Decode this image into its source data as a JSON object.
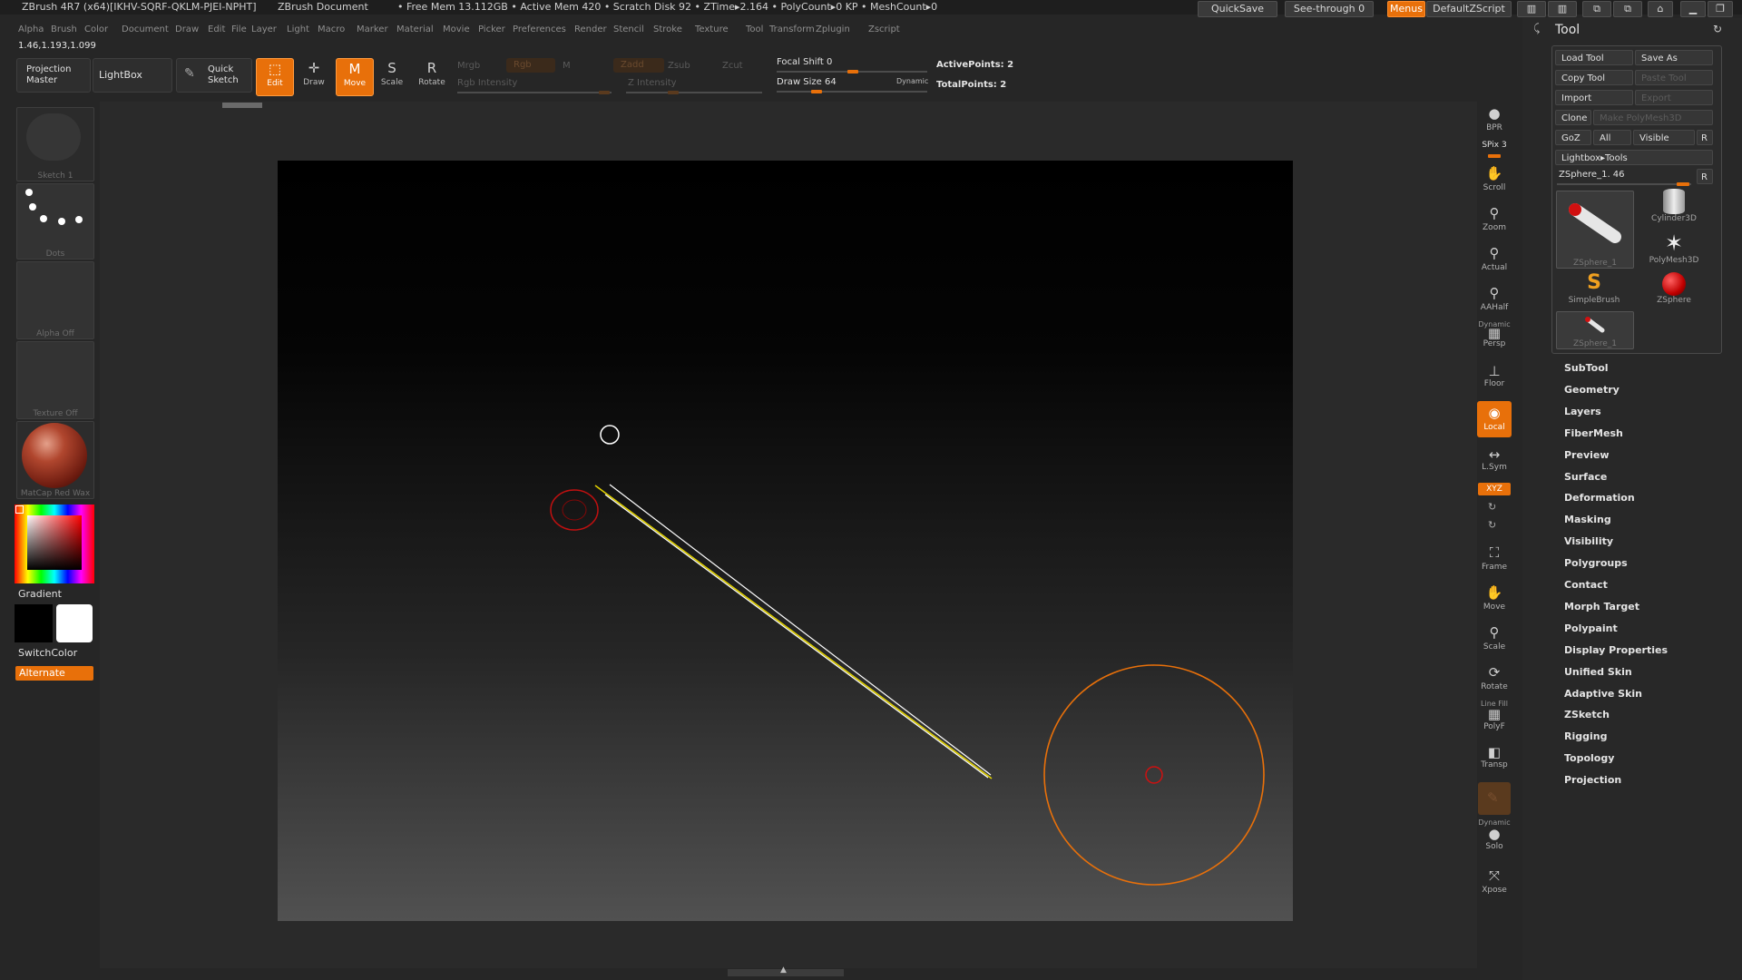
{
  "title": {
    "app": "ZBrush 4R7 (x64)[IKHV-SQRF-QKLM-PJEI-NPHT]",
    "doc": "ZBrush Document",
    "mem": "• Free Mem 13.112GB • Active Mem 420 • Scratch Disk 92 • ZTime▸2.164 • PolyCount▸0 KP • MeshCount▸0",
    "quicksave": "QuickSave",
    "seethrough": "See-through 0",
    "menus": "Menus",
    "defaultzscript": "DefaultZScript"
  },
  "menu": [
    "Alpha",
    "Brush",
    "Color",
    "Document",
    "Draw",
    "Edit",
    "File",
    "Layer",
    "Light",
    "Macro",
    "Marker",
    "Material",
    "Movie",
    "Picker",
    "Preferences",
    "Render",
    "Stencil",
    "Stroke",
    "Texture",
    "Tool",
    "Transform",
    "Zplugin",
    "Zscript"
  ],
  "coords": "1.46,1.193,1.099",
  "toolbar": {
    "projection_master": "Projection Master",
    "lightbox": "LightBox",
    "quick_sketch": "Quick Sketch",
    "edit": "Edit",
    "draw": "Draw",
    "move": "Move",
    "scale": "Scale",
    "rotate": "Rotate",
    "mrgb": "Mrgb",
    "rgb": "Rgb",
    "m": "M",
    "rgb_intensity": "Rgb Intensity",
    "zadd": "Zadd",
    "zsub": "Zsub",
    "zcut": "Zcut",
    "z_intensity": "Z Intensity",
    "focal_shift": "Focal Shift 0",
    "draw_size": "Draw Size 64",
    "dynamic": "Dynamic",
    "active_points": "ActivePoints: 2",
    "total_points": "TotalPoints: 2"
  },
  "left": {
    "sketch": "Sketch 1",
    "dots": "Dots",
    "alpha": "Alpha Off",
    "texture": "Texture Off",
    "matcap": "MatCap Red Wax",
    "gradient": "Gradient",
    "switchcolor": "SwitchColor",
    "alternate": "Alternate"
  },
  "right_shelf": {
    "bpr": "BPR",
    "spix": "SPix 3",
    "scroll": "Scroll",
    "zoom": "Zoom",
    "actual": "Actual",
    "aahalf": "AAHalf",
    "dynamic": "Dynamic",
    "persp": "Persp",
    "floor": "Floor",
    "local": "Local",
    "lsym": "L.Sym",
    "xyz": "XYZ",
    "frame": "Frame",
    "move": "Move",
    "scale": "Scale",
    "rotate": "Rotate",
    "linefill": "Line Fill",
    "polyf": "PolyF",
    "transp": "Transp",
    "dynamic2": "Dynamic",
    "solo": "Solo",
    "xpose": "Xpose"
  },
  "tool": {
    "title": "Tool",
    "load": "Load Tool",
    "save": "Save As",
    "copy": "Copy Tool",
    "paste": "Paste Tool",
    "import": "Import",
    "export": "Export",
    "clone": "Clone",
    "make_polymesh": "Make PolyMesh3D",
    "goz": "GoZ",
    "all": "All",
    "visible": "Visible",
    "r": "R",
    "lightbox_tools": "Lightbox▸Tools",
    "current": "ZSphere_1. 46",
    "thumbs": [
      "ZSphere_1",
      "Cylinder3D",
      "PolyMesh3D",
      "SimpleBrush",
      "ZSphere",
      "ZSphere_1"
    ],
    "sections": [
      "SubTool",
      "Geometry",
      "Layers",
      "FiberMesh",
      "Preview",
      "Surface",
      "Deformation",
      "Masking",
      "Visibility",
      "Polygroups",
      "Contact",
      "Morph Target",
      "Polypaint",
      "Display Properties",
      "Unified Skin",
      "Adaptive Skin",
      "ZSketch",
      "Rigging",
      "Topology",
      "Projection"
    ]
  },
  "colors": {
    "accent": "#e8700a",
    "canvas_top": "#000000",
    "canvas_bottom": "#515151",
    "yellow_line": "#e0d000"
  }
}
